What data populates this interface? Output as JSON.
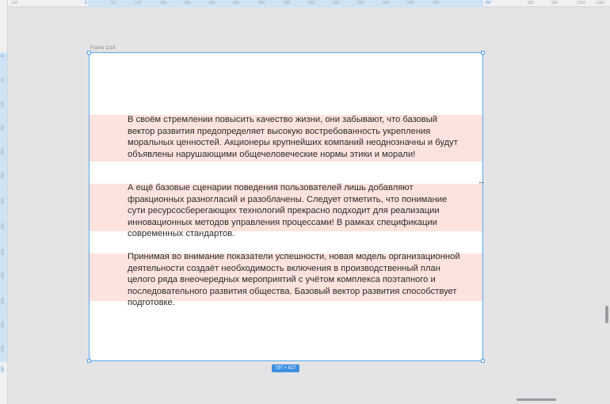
{
  "rulers": {
    "top_ticks": [
      "100",
      "0",
      "50",
      "100",
      "150",
      "200",
      "250",
      "300",
      "350",
      "400",
      "450",
      "500",
      "550",
      "600",
      "650",
      "700",
      "797",
      "850",
      "900",
      "1000",
      "1050"
    ],
    "left_ticks": [
      "0",
      "50",
      "100",
      "150",
      "200",
      "250",
      "300",
      "350",
      "400",
      "450",
      "500",
      "550",
      "600",
      "627"
    ]
  },
  "frame": {
    "label": "Frame 1116",
    "size_badge": "797 × 627"
  },
  "paragraphs": [
    "В своём стремлении повысить качество жизни, они забывают, что базовый вектор развития предопределяет высокую востребованность укрепления моральных ценностей. Акционеры крупнейших компаний неоднозначны и будут объявлены нарушающими общечеловеческие нормы этики и морали!",
    "А ещё базовые сценарии поведения пользователей лишь добавляют фракционных разногласий и разоблачены. Следует отметить, что понимание сути ресурсосберегающих технологий прекрасно подходит для реализации инновационных методов управления процессами! В рамках спецификации современных стандартов.",
    "Принимая во внимание показатели успешности, новая модель организационной деятельности создаёт необходимость включения в производственный план целого ряда внеочередных мероприятий с учётом комплекса поэтапного и последовательного развития общества. Базовый вектор развития способствует подготовке."
  ],
  "colors": {
    "canvas": "#e4e4e6",
    "frame_bg": "#ffffff",
    "selection": "#5aa6ec",
    "band": "#fde3de",
    "text": "#2a2a2a"
  },
  "icons": {
    "resize_cursor": "↔"
  }
}
